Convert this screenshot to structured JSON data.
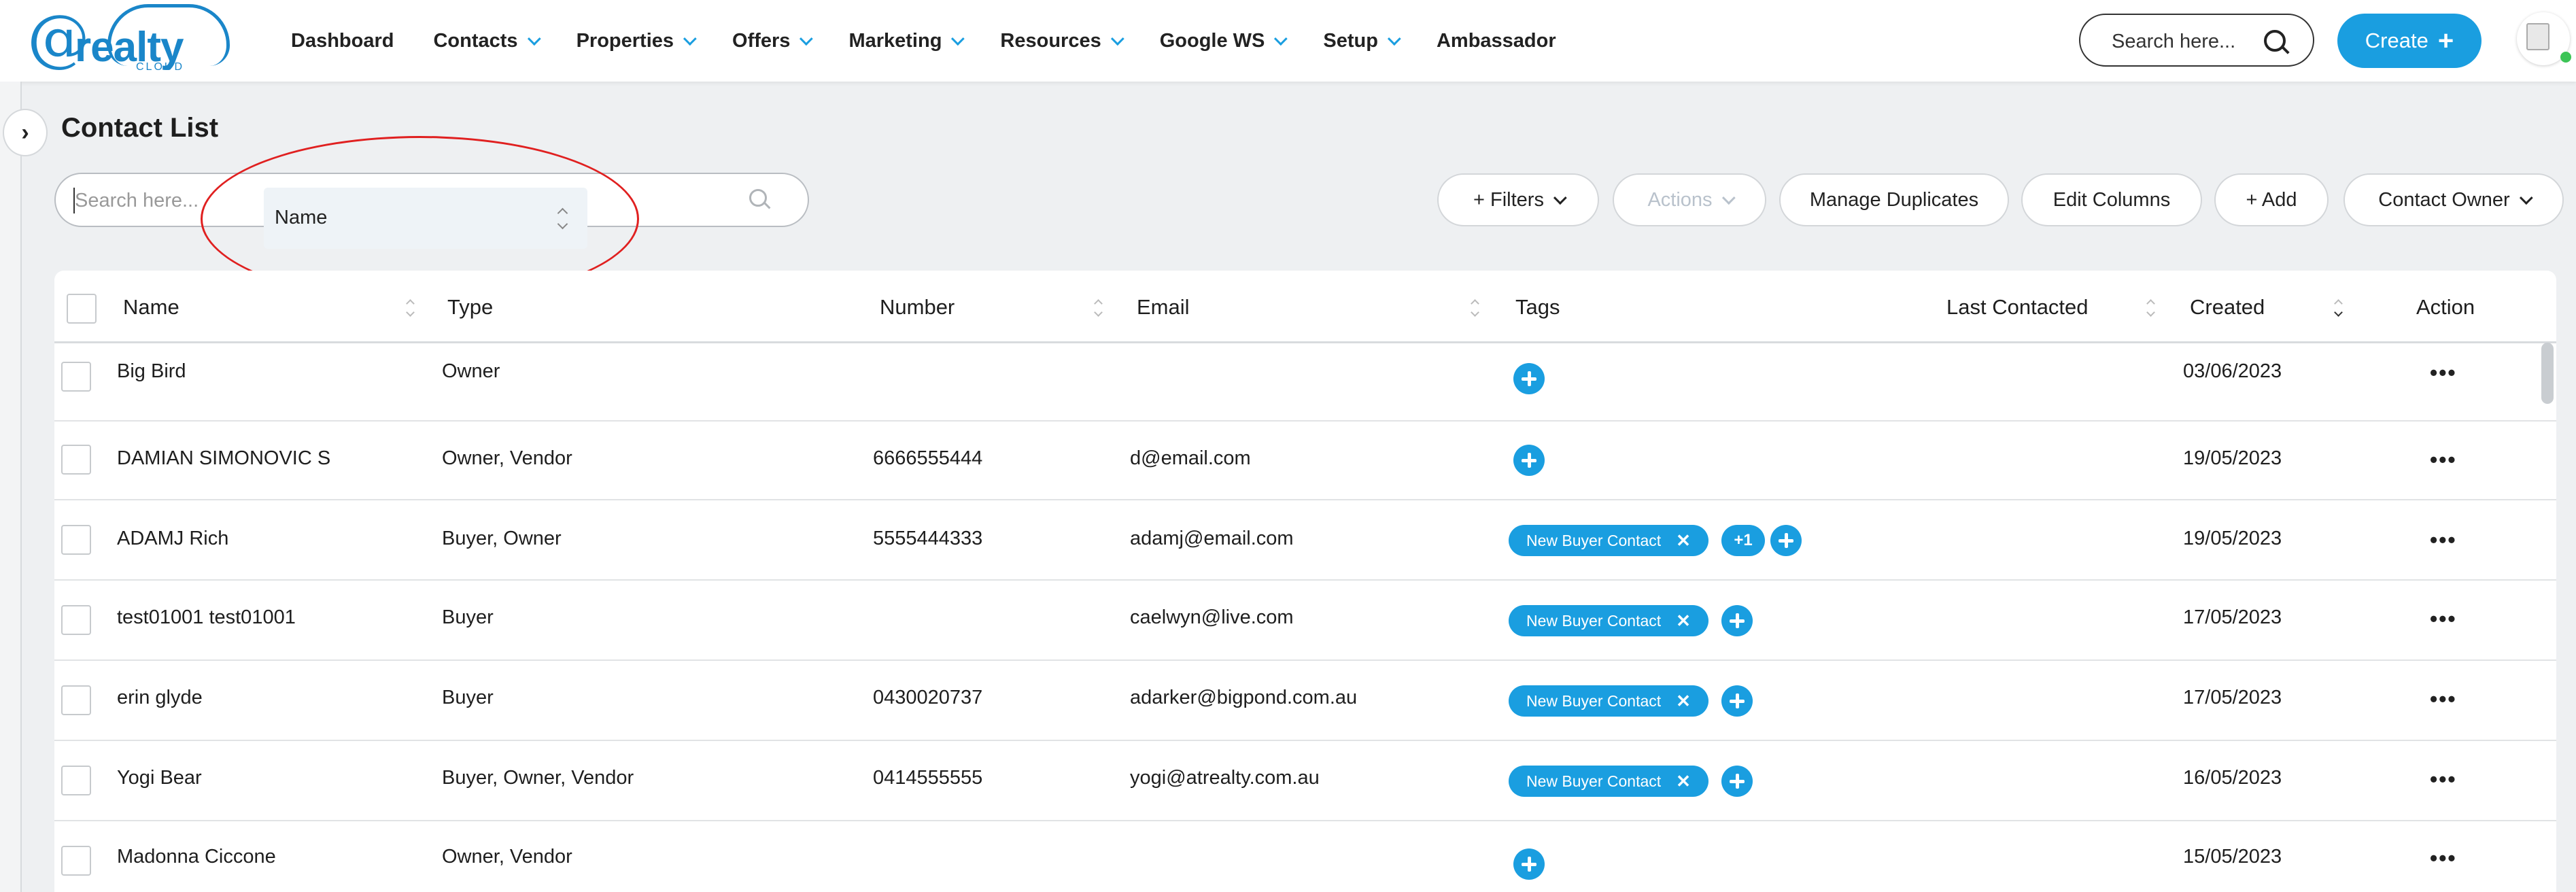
{
  "brand": {
    "at": "@",
    "word": "realty",
    "sub": "CLOUD"
  },
  "nav": [
    {
      "label": "Dashboard",
      "has_dropdown": false
    },
    {
      "label": "Contacts",
      "has_dropdown": true
    },
    {
      "label": "Properties",
      "has_dropdown": true
    },
    {
      "label": "Offers",
      "has_dropdown": true
    },
    {
      "label": "Marketing",
      "has_dropdown": true
    },
    {
      "label": "Resources",
      "has_dropdown": true
    },
    {
      "label": "Google WS",
      "has_dropdown": true
    },
    {
      "label": "Setup",
      "has_dropdown": true
    },
    {
      "label": "Ambassador",
      "has_dropdown": false
    }
  ],
  "header": {
    "search_placeholder": "Search here...",
    "create_label": "Create",
    "create_plus": "+"
  },
  "sidebar_toggle": "›",
  "page_title": "Contact List",
  "list_search": {
    "placeholder": "Search here...",
    "field_selected": "Name"
  },
  "toolbar": {
    "filters": "+ Filters",
    "actions": "Actions",
    "manage_duplicates": "Manage Duplicates",
    "edit_columns": "Edit Columns",
    "add": "+ Add",
    "contact_owner": "Contact Owner"
  },
  "table": {
    "columns": [
      "Name",
      "Type",
      "Number",
      "Email",
      "Tags",
      "Last Contacted",
      "Created",
      "Action"
    ],
    "rows": [
      {
        "name": "Big Bird",
        "type": "Owner",
        "number": "",
        "email": "",
        "tags": [],
        "more": "",
        "last_contacted": "",
        "created": "03/06/2023",
        "action": "•••"
      },
      {
        "name": "DAMIAN SIMONOVIC S",
        "type": "Owner, Vendor",
        "number": "6666555444",
        "email": "d@email.com",
        "tags": [],
        "more": "",
        "last_contacted": "",
        "created": "19/05/2023",
        "action": "•••"
      },
      {
        "name": "ADAMJ Rich",
        "type": "Buyer, Owner",
        "number": "5555444333",
        "email": "adamj@email.com",
        "tags": [
          "New Buyer Contact"
        ],
        "more": "+1",
        "last_contacted": "",
        "created": "19/05/2023",
        "action": "•••"
      },
      {
        "name": "test01001 test01001",
        "type": "Buyer",
        "number": "",
        "email": "caelwyn@live.com",
        "tags": [
          "New Buyer Contact"
        ],
        "more": "",
        "last_contacted": "",
        "created": "17/05/2023",
        "action": "•••"
      },
      {
        "name": "erin glyde",
        "type": "Buyer",
        "number": "0430020737",
        "email": "adarker@bigpond.com.au",
        "tags": [
          "New Buyer Contact"
        ],
        "more": "",
        "last_contacted": "",
        "created": "17/05/2023",
        "action": "•••"
      },
      {
        "name": "Yogi Bear",
        "type": "Buyer, Owner, Vendor",
        "number": "0414555555",
        "email": "yogi@atrealty.com.au",
        "tags": [
          "New Buyer Contact"
        ],
        "more": "",
        "last_contacted": "",
        "created": "16/05/2023",
        "action": "•••"
      },
      {
        "name": "Madonna Ciccone",
        "type": "Owner, Vendor",
        "number": "",
        "email": "",
        "tags": [],
        "more": "",
        "last_contacted": "",
        "created": "15/05/2023",
        "action": "•••"
      }
    ],
    "tag_remove_glyph": "✕"
  },
  "colors": {
    "accent": "#1a9ee0",
    "highlight_ellipse": "#e02020",
    "online_dot": "#3cc456"
  },
  "icons": [
    "search-icon",
    "plus-icon",
    "chevron-down-icon",
    "chevron-right-icon",
    "sort-icon",
    "more-icon",
    "close-icon",
    "avatar-icon"
  ]
}
